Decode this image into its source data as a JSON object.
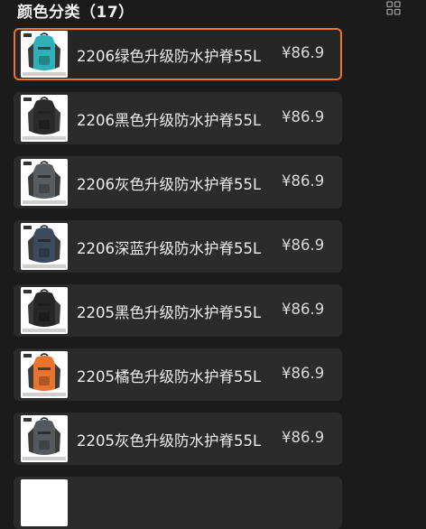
{
  "header": {
    "title": "颜色分类（17）",
    "grid_icon": "grid-view-icon"
  },
  "accent_color": "#e9762a",
  "items": [
    {
      "name": "2206绿色升级防水护脊55L",
      "price": "¥86.9",
      "pack_color": "#2fb0b8",
      "selected": true
    },
    {
      "name": "2206黑色升级防水护脊55L",
      "price": "¥86.9",
      "pack_color": "#2a2a2a",
      "selected": false
    },
    {
      "name": "2206灰色升级防水护脊55L",
      "price": "¥86.9",
      "pack_color": "#5a5d60",
      "selected": false
    },
    {
      "name": "2206深蓝升级防水护脊55L",
      "price": "¥86.9",
      "pack_color": "#3c4a5e",
      "selected": false
    },
    {
      "name": "2205黑色升级防水护脊55L",
      "price": "¥86.9",
      "pack_color": "#262626",
      "selected": false
    },
    {
      "name": "2205橘色升级防水护脊55L",
      "price": "¥86.9",
      "pack_color": "#e8742e",
      "selected": false
    },
    {
      "name": "2205灰色升级防水护脊55L",
      "price": "¥86.9",
      "pack_color": "#55585c",
      "selected": false
    }
  ]
}
